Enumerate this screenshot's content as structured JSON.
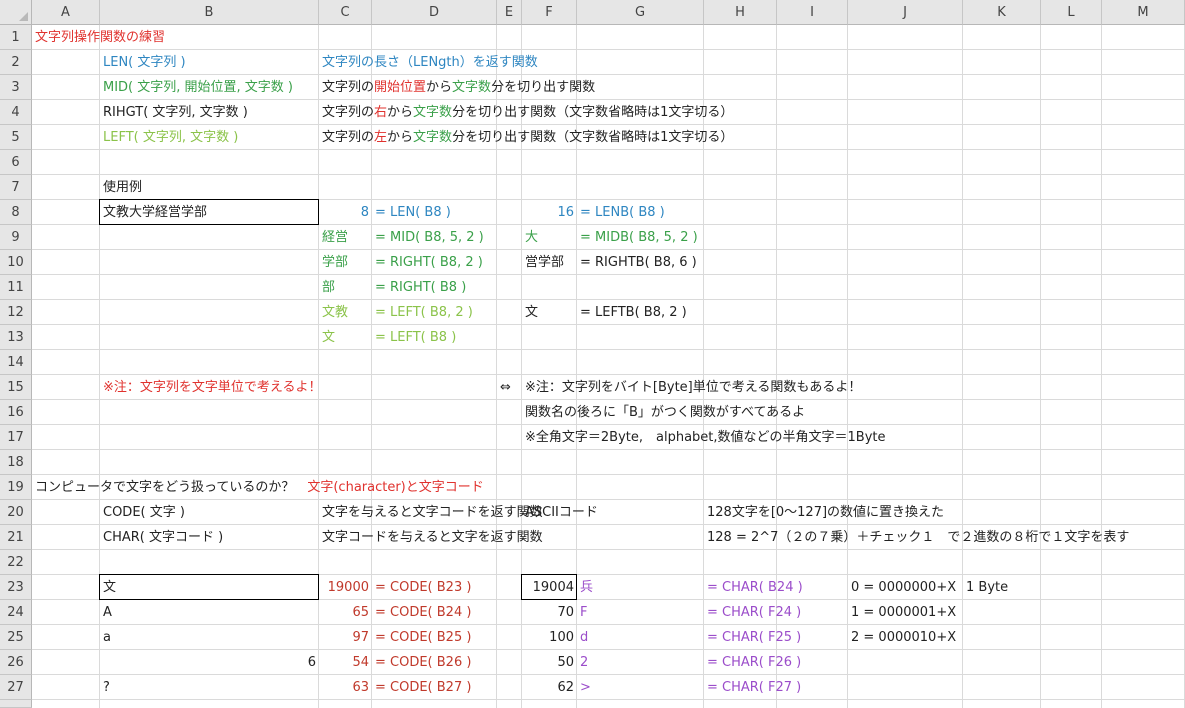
{
  "columns": [
    "A",
    "B",
    "C",
    "D",
    "E",
    "F",
    "G",
    "H",
    "I",
    "J",
    "K",
    "L",
    "M"
  ],
  "rows": [
    "1",
    "2",
    "3",
    "4",
    "5",
    "6",
    "7",
    "8",
    "9",
    "10",
    "11",
    "12",
    "13",
    "14",
    "15",
    "16",
    "17",
    "18",
    "19",
    "20",
    "21",
    "22",
    "23",
    "24",
    "25",
    "26",
    "27"
  ],
  "colors": {
    "red": "#e0322e",
    "blue": "#2e86c1",
    "green": "#3aa049",
    "light_green": "#8bc34a",
    "purple": "#9b4dca",
    "dark_red": "#c0392b"
  },
  "cells": [
    {
      "ref": "A1",
      "text": "文字列操作関数の練習",
      "color": "red"
    },
    {
      "ref": "B2",
      "text": "LEN( 文字列 )",
      "color": "blue"
    },
    {
      "ref": "C2",
      "text": "文字列の長さ（LENgth）を返す関数",
      "color": "blue"
    },
    {
      "ref": "B3",
      "text": "MID( 文字列, 開始位置, 文字数 )",
      "color": "green"
    },
    {
      "ref": "C3",
      "parts": [
        {
          "t": "文字列の",
          "c": "dark"
        },
        {
          "t": "開始位置",
          "c": "red"
        },
        {
          "t": "から",
          "c": "dark"
        },
        {
          "t": "文字数",
          "c": "green"
        },
        {
          "t": "分を切り出す関数",
          "c": "dark"
        }
      ]
    },
    {
      "ref": "B4",
      "text": "RIHGT( 文字列, 文字数 )",
      "color": "dark"
    },
    {
      "ref": "C4",
      "parts": [
        {
          "t": "文字列の",
          "c": "dark"
        },
        {
          "t": "右",
          "c": "red"
        },
        {
          "t": "から",
          "c": "dark"
        },
        {
          "t": "文字数",
          "c": "green"
        },
        {
          "t": "分を切り出す関数（文字数省略時は1文字切る）",
          "c": "dark"
        }
      ]
    },
    {
      "ref": "B5",
      "text": "LEFT( 文字列, 文字数 )",
      "color": "light_green"
    },
    {
      "ref": "C5",
      "parts": [
        {
          "t": "文字列の",
          "c": "dark"
        },
        {
          "t": "左",
          "c": "red"
        },
        {
          "t": "から",
          "c": "dark"
        },
        {
          "t": "文字数",
          "c": "green"
        },
        {
          "t": "分を切り出す関数（文字数省略時は1文字切る）",
          "c": "dark"
        }
      ]
    },
    {
      "ref": "B7",
      "text": "使用例",
      "color": "dark"
    },
    {
      "ref": "B8",
      "text": "文教大学経営学部",
      "color": "dark",
      "boxed": true
    },
    {
      "ref": "C8",
      "text": "8",
      "color": "blue",
      "align": "right"
    },
    {
      "ref": "D8",
      "text": "= LEN( B8 )",
      "color": "blue"
    },
    {
      "ref": "F8",
      "text": "16",
      "color": "blue",
      "align": "right"
    },
    {
      "ref": "G8",
      "text": "= LENB( B8 )",
      "color": "blue"
    },
    {
      "ref": "C9",
      "text": "経営",
      "color": "green"
    },
    {
      "ref": "D9",
      "text": "= MID( B8, 5, 2 )",
      "color": "green"
    },
    {
      "ref": "F9",
      "text": "大",
      "color": "green"
    },
    {
      "ref": "G9",
      "text": "= MIDB( B8, 5, 2 )",
      "color": "green"
    },
    {
      "ref": "C10",
      "text": "学部",
      "color": "green"
    },
    {
      "ref": "D10",
      "text": "= RIGHT( B8, 2 )",
      "color": "green"
    },
    {
      "ref": "F10",
      "text": "営学部",
      "color": "dark"
    },
    {
      "ref": "G10",
      "text": "= RIGHTB( B8, 6 )",
      "color": "dark"
    },
    {
      "ref": "C11",
      "text": "部",
      "color": "green"
    },
    {
      "ref": "D11",
      "text": "= RIGHT( B8 )",
      "color": "green"
    },
    {
      "ref": "C12",
      "text": "文教",
      "color": "light_green"
    },
    {
      "ref": "D12",
      "text": "= LEFT( B8, 2 )",
      "color": "light_green"
    },
    {
      "ref": "F12",
      "text": "文",
      "color": "dark"
    },
    {
      "ref": "G12",
      "text": "= LEFTB( B8, 2 )",
      "color": "dark"
    },
    {
      "ref": "C13",
      "text": "文",
      "color": "light_green"
    },
    {
      "ref": "D13",
      "text": "= LEFT( B8 )",
      "color": "light_green"
    },
    {
      "ref": "B15",
      "text": "※注：文字列を文字単位で考えるよ！",
      "color": "red"
    },
    {
      "ref": "E15",
      "text": "⇔",
      "color": "dark"
    },
    {
      "ref": "F15",
      "text": "※注：文字列をバイト[Byte]単位で考える関数もあるよ！",
      "color": "dark"
    },
    {
      "ref": "F16",
      "text": "関数名の後ろに「B」がつく関数がすべてあるよ",
      "color": "dark"
    },
    {
      "ref": "F17",
      "text": "※全角文字＝2Byte,　alphabet,数値などの半角文字＝1Byte",
      "color": "dark"
    },
    {
      "ref": "A19",
      "parts": [
        {
          "t": "コンピュータで文字をどう扱っているのか？　",
          "c": "dark"
        },
        {
          "t": "文字(character)と文字コード",
          "c": "red"
        }
      ]
    },
    {
      "ref": "B20",
      "text": "CODE( 文字 )",
      "color": "dark"
    },
    {
      "ref": "C20",
      "text": "文字を与えると文字コードを返す関数",
      "color": "dark"
    },
    {
      "ref": "F20",
      "text": "ASCIIコード",
      "color": "dark"
    },
    {
      "ref": "H20",
      "text": "128文字を[0～127]の数値に置き換えた",
      "color": "dark"
    },
    {
      "ref": "B21",
      "text": "CHAR( 文字コード )",
      "color": "dark"
    },
    {
      "ref": "C21",
      "text": "文字コードを与えると文字を返す関数",
      "color": "dark"
    },
    {
      "ref": "H21",
      "text": "128 = 2^7（２の７乗）＋チェック１　で２進数の８桁で１文字を表す",
      "color": "dark"
    },
    {
      "ref": "B23",
      "text": "文",
      "color": "dark",
      "boxed": true
    },
    {
      "ref": "C23",
      "text": "19000",
      "color": "dark_red",
      "align": "right"
    },
    {
      "ref": "D23",
      "text": "= CODE( B23 )",
      "color": "dark_red"
    },
    {
      "ref": "F23",
      "text": "19004",
      "color": "dark",
      "align": "right",
      "boxed": true
    },
    {
      "ref": "G23",
      "text": "兵",
      "color": "purple"
    },
    {
      "ref": "H23",
      "text": "= CHAR( B24 )",
      "color": "purple"
    },
    {
      "ref": "J23",
      "text": "0 = 0000000+X",
      "color": "dark"
    },
    {
      "ref": "K23",
      "text": "1 Byte",
      "color": "dark"
    },
    {
      "ref": "B24",
      "text": "A",
      "color": "dark"
    },
    {
      "ref": "C24",
      "text": "65",
      "color": "dark_red",
      "align": "right"
    },
    {
      "ref": "D24",
      "text": "= CODE( B24 )",
      "color": "dark_red"
    },
    {
      "ref": "F24",
      "text": "70",
      "color": "dark",
      "align": "right"
    },
    {
      "ref": "G24",
      "text": "F",
      "color": "purple"
    },
    {
      "ref": "H24",
      "text": "= CHAR( F24 )",
      "color": "purple"
    },
    {
      "ref": "J24",
      "text": "1 = 0000001+X",
      "color": "dark"
    },
    {
      "ref": "B25",
      "text": "a",
      "color": "dark"
    },
    {
      "ref": "C25",
      "text": "97",
      "color": "dark_red",
      "align": "right"
    },
    {
      "ref": "D25",
      "text": "= CODE( B25 )",
      "color": "dark_red"
    },
    {
      "ref": "F25",
      "text": "100",
      "color": "dark",
      "align": "right"
    },
    {
      "ref": "G25",
      "text": "d",
      "color": "purple"
    },
    {
      "ref": "H25",
      "text": "= CHAR( F25 )",
      "color": "purple"
    },
    {
      "ref": "J25",
      "text": "2 = 0000010+X",
      "color": "dark"
    },
    {
      "ref": "B26",
      "text": "6",
      "color": "dark",
      "align": "right"
    },
    {
      "ref": "C26",
      "text": "54",
      "color": "dark_red",
      "align": "right"
    },
    {
      "ref": "D26",
      "text": "= CODE( B26 )",
      "color": "dark_red"
    },
    {
      "ref": "F26",
      "text": "50",
      "color": "dark",
      "align": "right"
    },
    {
      "ref": "G26",
      "text": "2",
      "color": "purple"
    },
    {
      "ref": "H26",
      "text": "= CHAR( F26 )",
      "color": "purple"
    },
    {
      "ref": "B27",
      "text": "?",
      "color": "dark"
    },
    {
      "ref": "C27",
      "text": "63",
      "color": "dark_red",
      "align": "right"
    },
    {
      "ref": "D27",
      "text": "= CODE( B27 )",
      "color": "dark_red"
    },
    {
      "ref": "F27",
      "text": "62",
      "color": "dark",
      "align": "right"
    },
    {
      "ref": "G27",
      "text": ">",
      "color": "purple"
    },
    {
      "ref": "H27",
      "text": "= CHAR( F27 )",
      "color": "purple"
    }
  ]
}
